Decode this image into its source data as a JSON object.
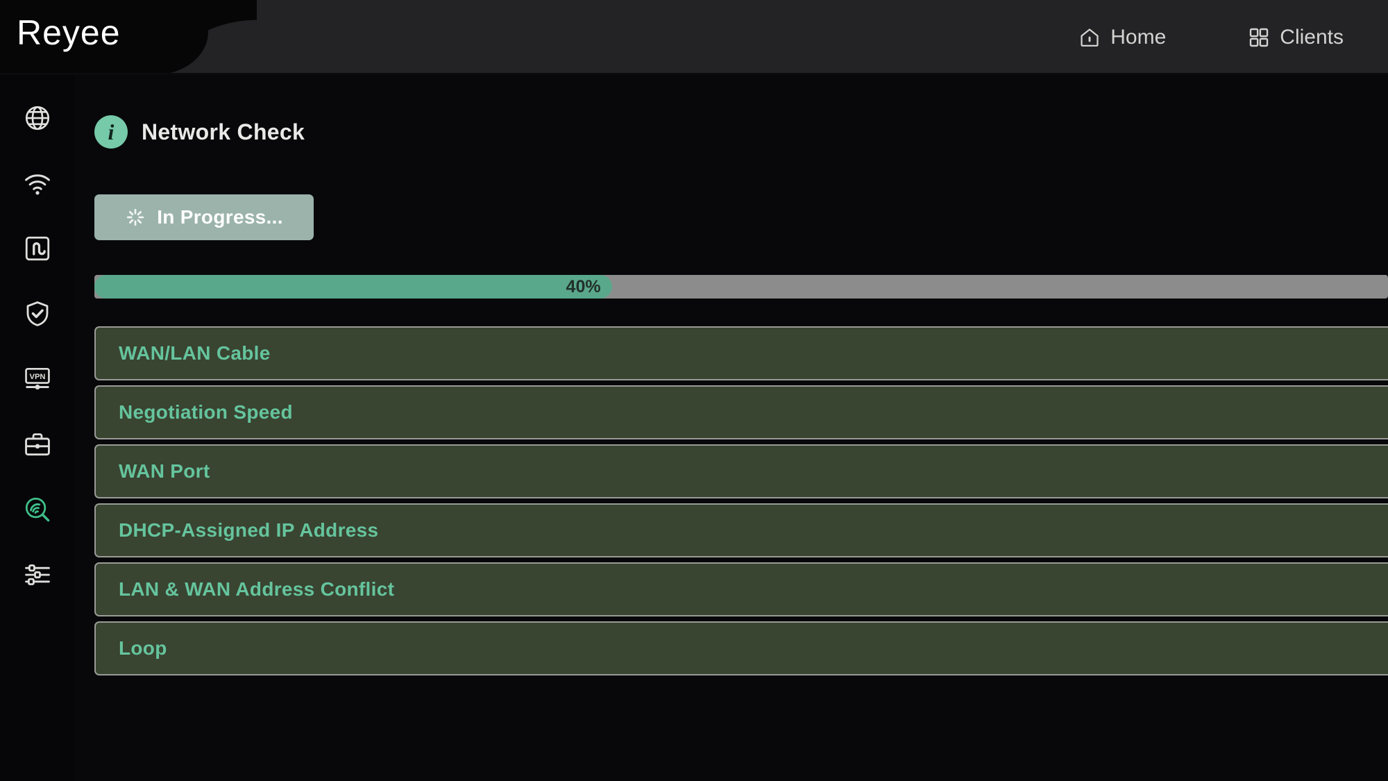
{
  "header": {
    "logo": "Reyee",
    "nav": [
      {
        "label": "Home",
        "icon": "home-icon"
      },
      {
        "label": "Clients",
        "icon": "grid-icon"
      }
    ]
  },
  "sidebar": {
    "items": [
      {
        "name": "globe-icon",
        "label": "Network",
        "active": false
      },
      {
        "name": "wifi-icon",
        "label": "Wi-Fi",
        "active": false
      },
      {
        "name": "switch-icon",
        "label": "Switches",
        "active": false
      },
      {
        "name": "shield-check-icon",
        "label": "Security",
        "active": false
      },
      {
        "name": "vpn-icon",
        "label": "VPN",
        "active": false
      },
      {
        "name": "toolbox-icon",
        "label": "Advanced",
        "active": false
      },
      {
        "name": "diagnostics-icon",
        "label": "Diagnostics",
        "active": true
      },
      {
        "name": "sliders-icon",
        "label": "System",
        "active": false
      }
    ]
  },
  "main": {
    "page_title": "Network Check",
    "info_badge": "i",
    "status_button": {
      "label": "In Progress...",
      "icon": "spinner-icon"
    },
    "progress": {
      "percent": 40,
      "percent_label": "40%"
    },
    "checks": [
      {
        "label": "WAN/LAN Cable"
      },
      {
        "label": "Negotiation Speed"
      },
      {
        "label": "WAN Port"
      },
      {
        "label": "DHCP-Assigned IP Address"
      },
      {
        "label": "LAN & WAN Address Conflict"
      },
      {
        "label": "Loop"
      }
    ]
  },
  "colors": {
    "accent_green": "#65c49d",
    "progress_fill": "#5aa88c",
    "progress_track": "#8c8c8c",
    "row_bg": "#394431",
    "button_bg": "#9bb3ab",
    "header_bg": "#232325",
    "page_bg": "#08080a"
  }
}
